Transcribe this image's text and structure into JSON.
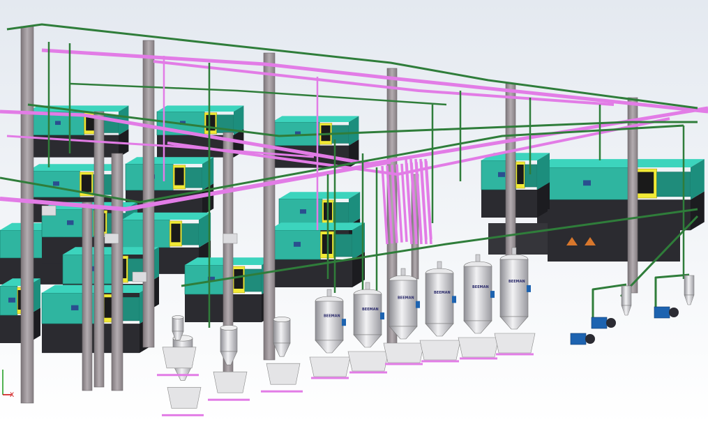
{
  "scene": {
    "description_visible_text": "none",
    "machine_label": "BEEMAN",
    "warning_label": "⚠",
    "triad_x_label": "X"
  },
  "colors": {
    "background_top": "#e7ecf2",
    "background_bottom": "#ffffff",
    "machine_body": "#2fb5a0",
    "machine_body_dark": "#1f8c7b",
    "machine_top": "#3cd4bd",
    "guard_yellow": "#f2ea35",
    "base_dark": "#2b2b30",
    "column_grey": "#9c9498",
    "pipe_green": "#2f7d3a",
    "pipe_magenta": "#e27ce6",
    "hopper_steel": "#c8c8cc",
    "blower_blue": "#1d63b0"
  },
  "icons": {
    "triad": "axis-triad-icon",
    "warning": "warning-triangle-icon"
  }
}
